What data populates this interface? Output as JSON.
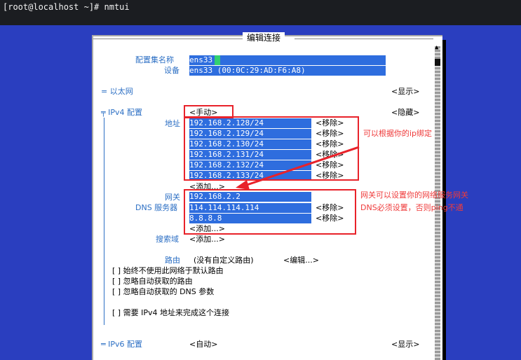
{
  "terminal": {
    "prompt": "[root@localhost ~]# nmtui"
  },
  "dialog": {
    "title": "编辑连接"
  },
  "profile": {
    "name_label": "配置集名称",
    "name_value": "ens33",
    "device_label": "设备",
    "device_value": "ens33 (00:0C:29:AD:F6:A8)"
  },
  "ethernet": {
    "label": "= 以太网",
    "toggle": "<显示>"
  },
  "ipv4": {
    "label": "╤ IPv4 配置",
    "mode": "<手动>",
    "toggle": "<隐藏>",
    "address_label": "地址",
    "addresses": [
      "192.168.2.128/24",
      "192.168.2.129/24",
      "192.168.2.130/24",
      "192.168.2.131/24",
      "192.168.2.132/24",
      "192.168.2.133/24"
    ],
    "remove_label": "<移除>",
    "add_label": "<添加...>",
    "gateway_label": "网关",
    "gateway_value": "192.168.2.2",
    "dns_label": "DNS 服务器",
    "dns": [
      "114.114.114.114",
      "8.8.8.8"
    ],
    "search_label": "搜索域",
    "routing_label": "路由",
    "routing_value": "(没有自定义路由)",
    "routing_edit": "<编辑...>",
    "options": [
      "[ ] 始终不使用此网络于默认路由",
      "[ ] 忽略自动获取的路由",
      "[ ] 忽略自动获取的 DNS 参数"
    ],
    "require_option": "[ ] 需要 IPv4 地址来完成这个连接"
  },
  "ipv6": {
    "label": "═ IPv6 配置",
    "mode": "<自动>",
    "toggle": "<显示>"
  },
  "annotations": {
    "ip_note": "可以根据你的ip绑定",
    "gw_note_1": "网关可以设置你的网络服务网关",
    "gw_note_2": "DNS必须设置，否则ping不通"
  },
  "colors": {
    "terminal_bg": "#1b1d21",
    "screen_bg": "#2a3ebf",
    "field_bg": "#2e6dde",
    "label_blue": "#2c6fc4",
    "annotation_red": "#e8222a"
  }
}
